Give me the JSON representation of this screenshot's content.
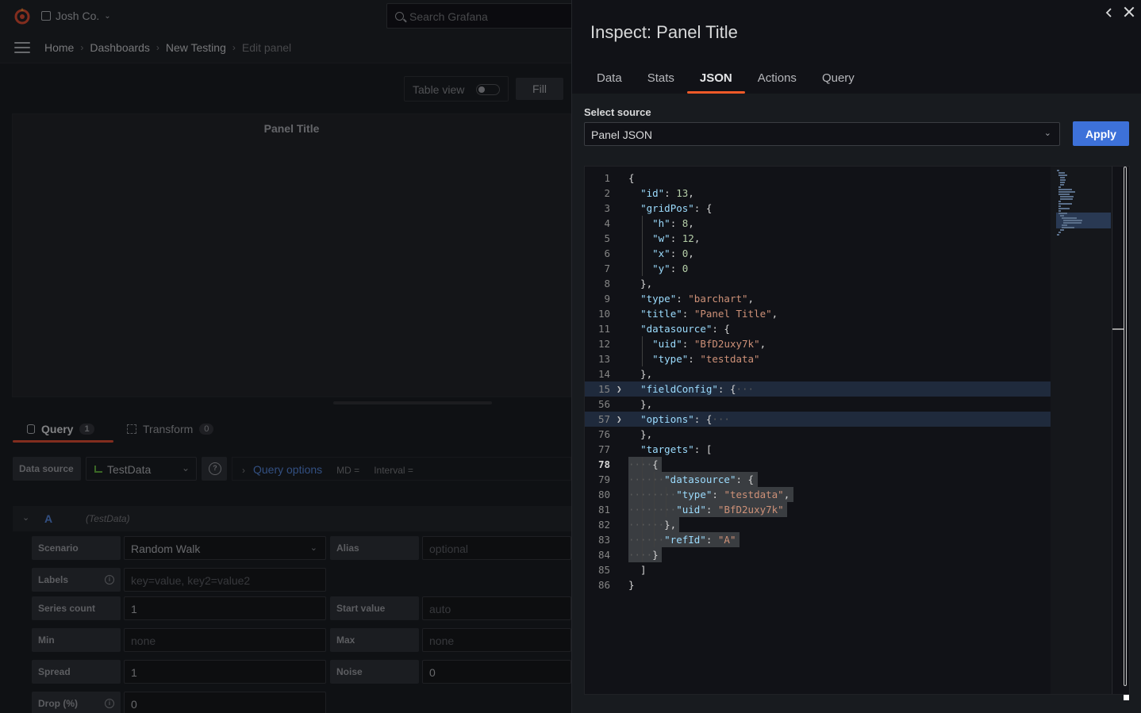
{
  "topbar": {
    "org_name": "Josh Co.",
    "search_placeholder": "Search Grafana"
  },
  "breadcrumb": {
    "items": [
      "Home",
      "Dashboards",
      "New Testing"
    ],
    "current": "Edit panel"
  },
  "panel_toolbar": {
    "table_view_label": "Table view",
    "table_view_on": false,
    "fill_label": "Fill"
  },
  "panel": {
    "title": "Panel Title"
  },
  "query_tabs": [
    {
      "label": "Query",
      "count": "1",
      "active": true
    },
    {
      "label": "Transform",
      "count": "0",
      "active": false
    }
  ],
  "datasource_row": {
    "label": "Data source",
    "selected": "TestData",
    "query_options_label": "Query options",
    "md": "MD =",
    "interval": "Interval ="
  },
  "query_row": {
    "ref": "A",
    "datasource": "(TestData)"
  },
  "query_fields": {
    "scenario_label": "Scenario",
    "scenario_value": "Random Walk",
    "alias_label": "Alias",
    "alias_placeholder": "optional",
    "labels_label": "Labels",
    "labels_placeholder": "key=value, key2=value2",
    "series_count_label": "Series count",
    "series_count_value": "1",
    "start_value_label": "Start value",
    "start_value_placeholder": "auto",
    "min_label": "Min",
    "min_placeholder": "none",
    "max_label": "Max",
    "max_placeholder": "none",
    "spread_label": "Spread",
    "spread_value": "1",
    "noise_label": "Noise",
    "noise_value": "0",
    "drop_label": "Drop (%)",
    "drop_value": "0"
  },
  "inspect": {
    "title": "Inspect: Panel Title",
    "tabs": [
      "Data",
      "Stats",
      "JSON",
      "Actions",
      "Query"
    ],
    "active_tab": "JSON",
    "select_source_label": "Select source",
    "select_source_value": "Panel JSON",
    "apply_label": "Apply"
  },
  "code_lines": [
    {
      "n": "1",
      "t": "{"
    },
    {
      "n": "2",
      "t": "  \"id\": 13,"
    },
    {
      "n": "3",
      "t": "  \"gridPos\": {"
    },
    {
      "n": "4",
      "t": "    \"h\": 8,"
    },
    {
      "n": "5",
      "t": "    \"w\": 12,"
    },
    {
      "n": "6",
      "t": "    \"x\": 0,"
    },
    {
      "n": "7",
      "t": "    \"y\": 0"
    },
    {
      "n": "8",
      "t": "  },"
    },
    {
      "n": "9",
      "t": "  \"type\": \"barchart\","
    },
    {
      "n": "10",
      "t": "  \"title\": \"Panel Title\","
    },
    {
      "n": "11",
      "t": "  \"datasource\": {"
    },
    {
      "n": "12",
      "t": "    \"uid\": \"BfD2uxy7k\","
    },
    {
      "n": "13",
      "t": "    \"type\": \"testdata\""
    },
    {
      "n": "14",
      "t": "  },"
    },
    {
      "n": "15",
      "t": "  \"fieldConfig\": {···",
      "fold": true
    },
    {
      "n": "56",
      "t": "  },"
    },
    {
      "n": "57",
      "t": "  \"options\": {···",
      "fold": true
    },
    {
      "n": "76",
      "t": "  },"
    },
    {
      "n": "77",
      "t": "  \"targets\": ["
    },
    {
      "n": "78",
      "t": "····{",
      "sel": true,
      "cur": true
    },
    {
      "n": "79",
      "t": "······\"datasource\": {",
      "sel": true
    },
    {
      "n": "80",
      "t": "········\"type\": \"testdata\",",
      "sel": true
    },
    {
      "n": "81",
      "t": "········\"uid\": \"BfD2uxy7k\"",
      "sel": true
    },
    {
      "n": "82",
      "t": "······},",
      "sel": true
    },
    {
      "n": "83",
      "t": "······\"refId\": \"A\"",
      "sel": true
    },
    {
      "n": "84",
      "t": "····}",
      "sel": true
    },
    {
      "n": "85",
      "t": "  ]"
    },
    {
      "n": "86",
      "t": "}"
    }
  ]
}
